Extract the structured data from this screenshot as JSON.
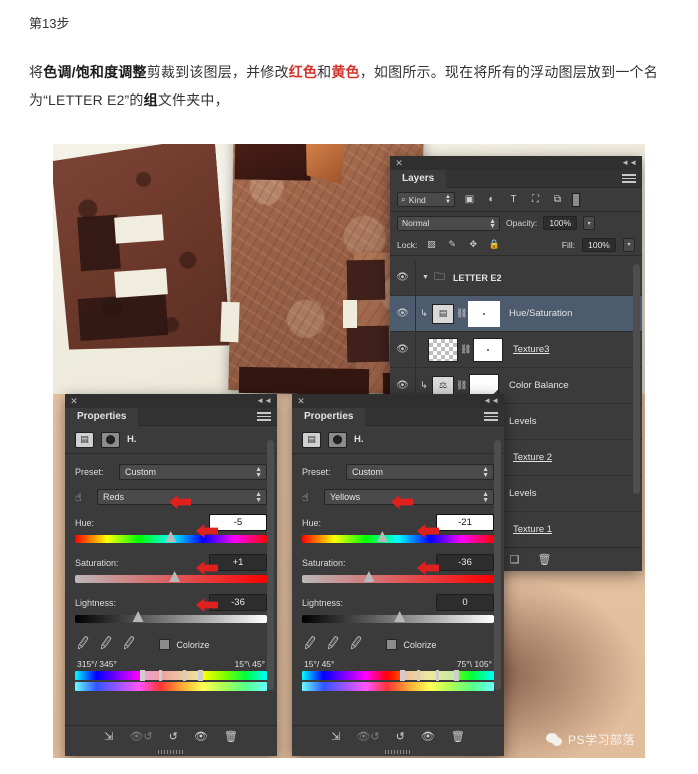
{
  "article": {
    "step_label": "第13步",
    "paragraph_parts": [
      {
        "t": "将",
        "style": "normal"
      },
      {
        "t": "色调/饱和度调整",
        "style": "bold"
      },
      {
        "t": "剪裁到该图层，并修改",
        "style": "normal"
      },
      {
        "t": "红色",
        "style": "red"
      },
      {
        "t": "和",
        "style": "normal"
      },
      {
        "t": "黄色",
        "style": "red"
      },
      {
        "t": "，如图所示。现在将所有的浮动图层放到一个名为“LETTER E2”的",
        "style": "normal"
      },
      {
        "t": "组",
        "style": "bold"
      },
      {
        "t": "文件夹中，",
        "style": "normal"
      }
    ]
  },
  "layers_panel": {
    "tab_title": "Layers",
    "filter": {
      "kind_label": "Kind",
      "icons": [
        "search-icon",
        "pixel-layer-filter-icon",
        "adjustment-layer-filter-icon",
        "type-layer-filter-icon",
        "shape-layer-filter-icon",
        "smart-object-filter-icon",
        "filter-toggle-icon"
      ]
    },
    "blend_mode": "Normal",
    "opacity_label": "Opacity:",
    "opacity_value": "100%",
    "lock_label": "Lock:",
    "fill_label": "Fill:",
    "fill_value": "100%",
    "rows": [
      {
        "name": "LETTER E2",
        "type": "group",
        "selected": false,
        "underline": false
      },
      {
        "name": "Hue/Saturation",
        "type": "adjustment",
        "selected": true,
        "underline": false
      },
      {
        "name": "Texture3",
        "type": "pixel",
        "selected": false,
        "underline": true
      },
      {
        "name": "Color Balance",
        "type": "adjustment",
        "selected": false,
        "underline": false
      },
      {
        "name": "Levels",
        "type": "adjustment",
        "selected": false,
        "underline": false
      },
      {
        "name": "Texture 2",
        "type": "pixel",
        "selected": false,
        "underline": true
      },
      {
        "name": "Levels",
        "type": "adjustment",
        "selected": false,
        "underline": false
      },
      {
        "name": "Texture 1",
        "type": "pixel",
        "selected": false,
        "underline": true
      }
    ],
    "bottom_icons": [
      "new-group-icon",
      "new-layer-icon",
      "delete-layer-icon"
    ]
  },
  "properties_left": {
    "tab_title": "Properties",
    "adjustment_title": "H.",
    "preset_label": "Preset:",
    "preset_value": "Custom",
    "channel_value": "Reds",
    "hue_label": "Hue:",
    "hue_value": "-5",
    "saturation_label": "Saturation:",
    "saturation_value": "+1",
    "lightness_label": "Lightness:",
    "lightness_value": "-36",
    "colorize_label": "Colorize",
    "range_left": "315°/ 345°",
    "range_right": "15°\\ 45°",
    "footer_icons": [
      "clip-to-layer-icon",
      "view-previous-state-icon",
      "reset-icon",
      "toggle-visibility-icon",
      "delete-icon"
    ]
  },
  "properties_right": {
    "tab_title": "Properties",
    "adjustment_title": "H.",
    "preset_label": "Preset:",
    "preset_value": "Custom",
    "channel_value": "Yellows",
    "hue_label": "Hue:",
    "hue_value": "-21",
    "saturation_label": "Saturation:",
    "saturation_value": "-36",
    "lightness_label": "Lightness:",
    "lightness_value": "0",
    "colorize_label": "Colorize",
    "range_left": "15°/ 45°",
    "range_right": "75°\\ 105°",
    "footer_icons": [
      "clip-to-layer-icon",
      "view-previous-state-icon",
      "reset-icon",
      "toggle-visibility-icon",
      "delete-icon"
    ]
  },
  "watermark": {
    "text": "PS学习部落",
    "icon": "wechat-icon"
  },
  "colors": {
    "panel_bg": "#3b3b3b",
    "panel_dark": "#2f2f2f",
    "selected_row": "#4c5b6e",
    "accent_red": "#e01f1f",
    "text": "#e0e0e0",
    "desk": "#e6c3a4",
    "artboard": "#f0ecde"
  }
}
